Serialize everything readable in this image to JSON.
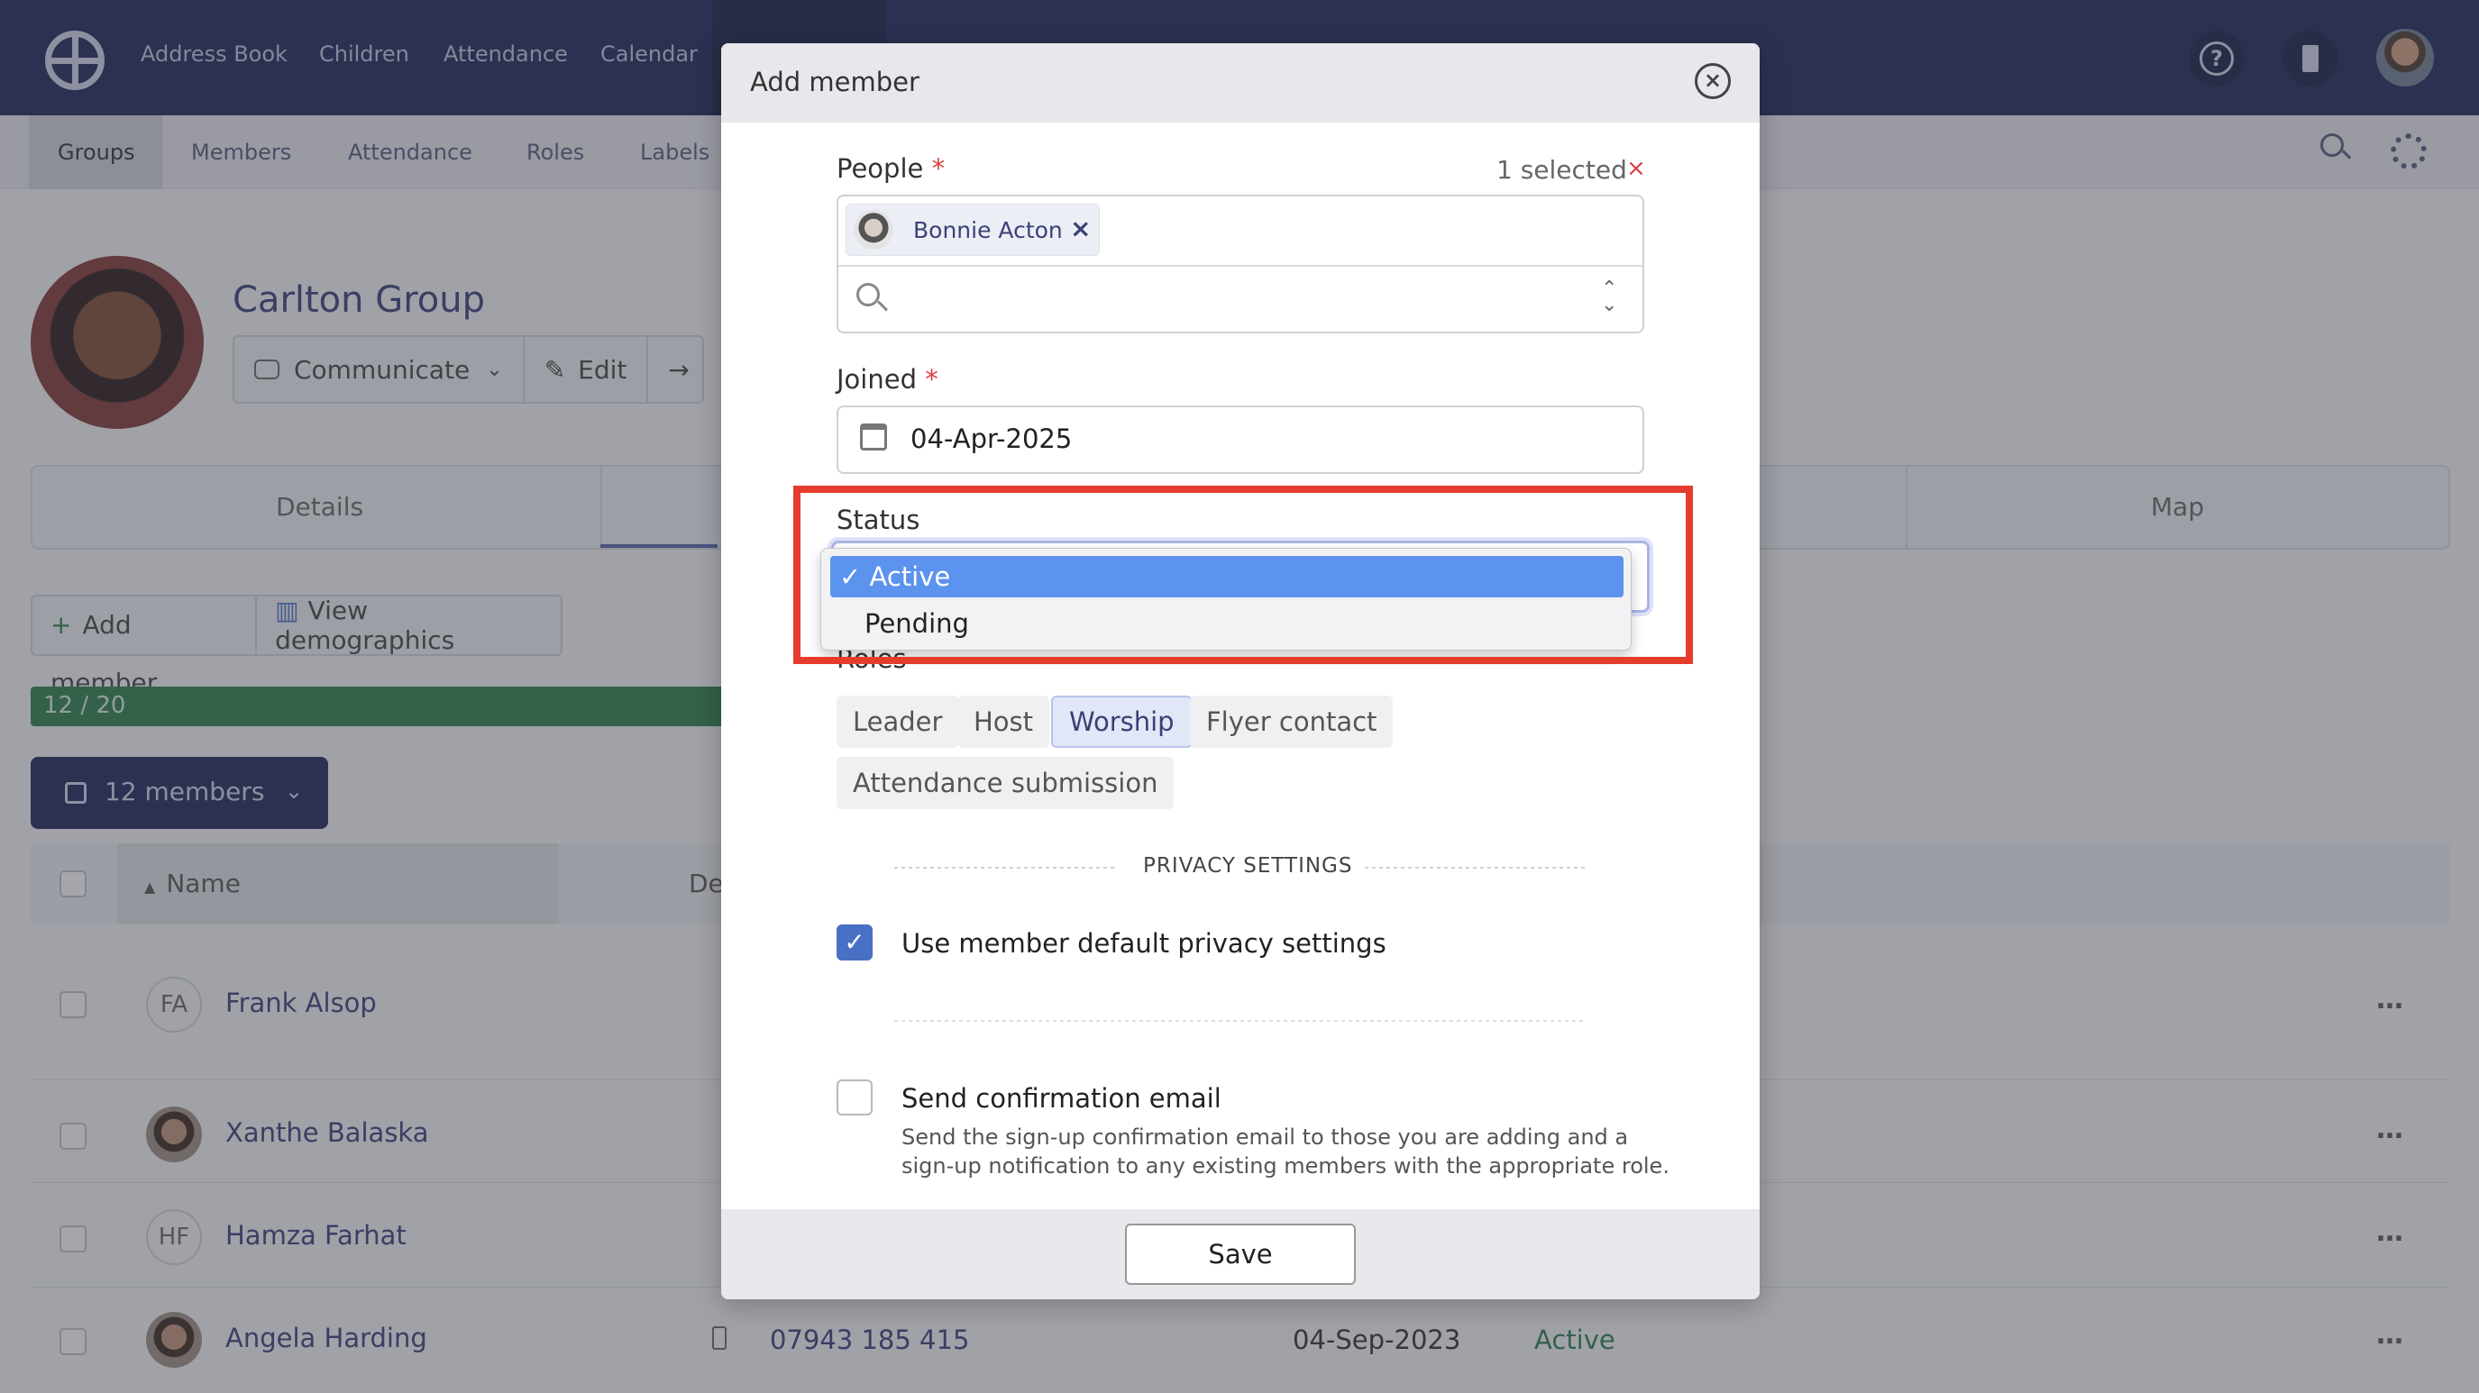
{
  "topnav": {
    "items": [
      "Address Book",
      "Children",
      "Attendance",
      "Calendar"
    ]
  },
  "subnav": {
    "items": [
      "Groups",
      "Members",
      "Attendance",
      "Roles",
      "Labels"
    ]
  },
  "group": {
    "title": "Carlton Group",
    "actions": [
      "Communicate",
      "Edit"
    ]
  },
  "tabs": [
    "Details",
    "Map"
  ],
  "members_toolbar": {
    "add_label": "Add member",
    "demographics_label": "View demographics",
    "capacity": "12 / 20",
    "capacity_fraction": 0.6,
    "members_button": "12 members"
  },
  "table": {
    "name_header": "Name",
    "de_header": "De",
    "rows": [
      {
        "initials": "FA",
        "name": "Frank Alsop"
      },
      {
        "initials": "",
        "name": "Xanthe Balaska"
      },
      {
        "initials": "HF",
        "name": "Hamza Farhat"
      },
      {
        "initials": "",
        "name": "Angela Harding",
        "phone": "07943 185 415",
        "joined": "04-Sep-2023",
        "status": "Active"
      }
    ],
    "more": "…"
  },
  "modal": {
    "title": "Add member",
    "people_label": "People",
    "required_mark": "*",
    "selected_count": "1 selected",
    "clear": "×",
    "person_chip": "Bonnie Acton",
    "joined_label": "Joined",
    "joined_value": "04-Apr-2025",
    "status_label": "Status",
    "status_options": [
      "✓ Active",
      "Pending"
    ],
    "roles_label": "Roles",
    "roles": [
      {
        "label": "Leader",
        "selected": false
      },
      {
        "label": "Host",
        "selected": false
      },
      {
        "label": "Worship",
        "selected": true
      },
      {
        "label": "Flyer contact",
        "selected": false
      },
      {
        "label": "Attendance submission",
        "selected": false
      }
    ],
    "privacy_heading": "PRIVACY SETTINGS",
    "privacy_default_label": "Use member default privacy settings",
    "privacy_default_checked": true,
    "confirmation_label": "Send confirmation email",
    "confirmation_checked": false,
    "confirmation_help": "Send the sign-up confirmation email to those you are adding and a sign-up notification to any existing members with the appropriate role.",
    "save_label": "Save"
  },
  "colors": {
    "nav": "#22295a",
    "accent": "#4a70c4",
    "highlight": "#e63c2e",
    "selected_option": "#5b93ee"
  }
}
